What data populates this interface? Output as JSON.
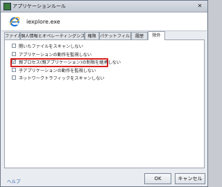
{
  "window": {
    "title": "アプリケーションルール",
    "close_glyph": "✕"
  },
  "app": {
    "name": "iexplore.exe",
    "icon": "internet-explorer-icon"
  },
  "tabs": [
    {
      "label": "ファイル",
      "active": false
    },
    {
      "label": "個人情報とオペレーティングシステム",
      "active": false
    },
    {
      "label": "権限",
      "active": false
    },
    {
      "label": "パケットフィルター",
      "active": false
    },
    {
      "label": "履歴",
      "active": false
    },
    {
      "label": "除外",
      "active": true
    }
  ],
  "options": [
    {
      "label": "開いたファイルをスキャンしない",
      "checked": false
    },
    {
      "label": "アプリケーションの動作を監視しない",
      "checked": false
    },
    {
      "label": "親プロセス(親アプリケーション)の制限を継承しない",
      "checked": true,
      "highlighted": true
    },
    {
      "label": "子アプリケーションの動作を監視しない",
      "checked": false
    },
    {
      "label": "ネットワークトラフィックをスキャンしない",
      "checked": false
    }
  ],
  "footer": {
    "help": "ヘルプ",
    "ok": "OK",
    "cancel": "キャンセル"
  },
  "colors": {
    "highlight": "#d81d1d",
    "link": "#2b5fb3"
  }
}
